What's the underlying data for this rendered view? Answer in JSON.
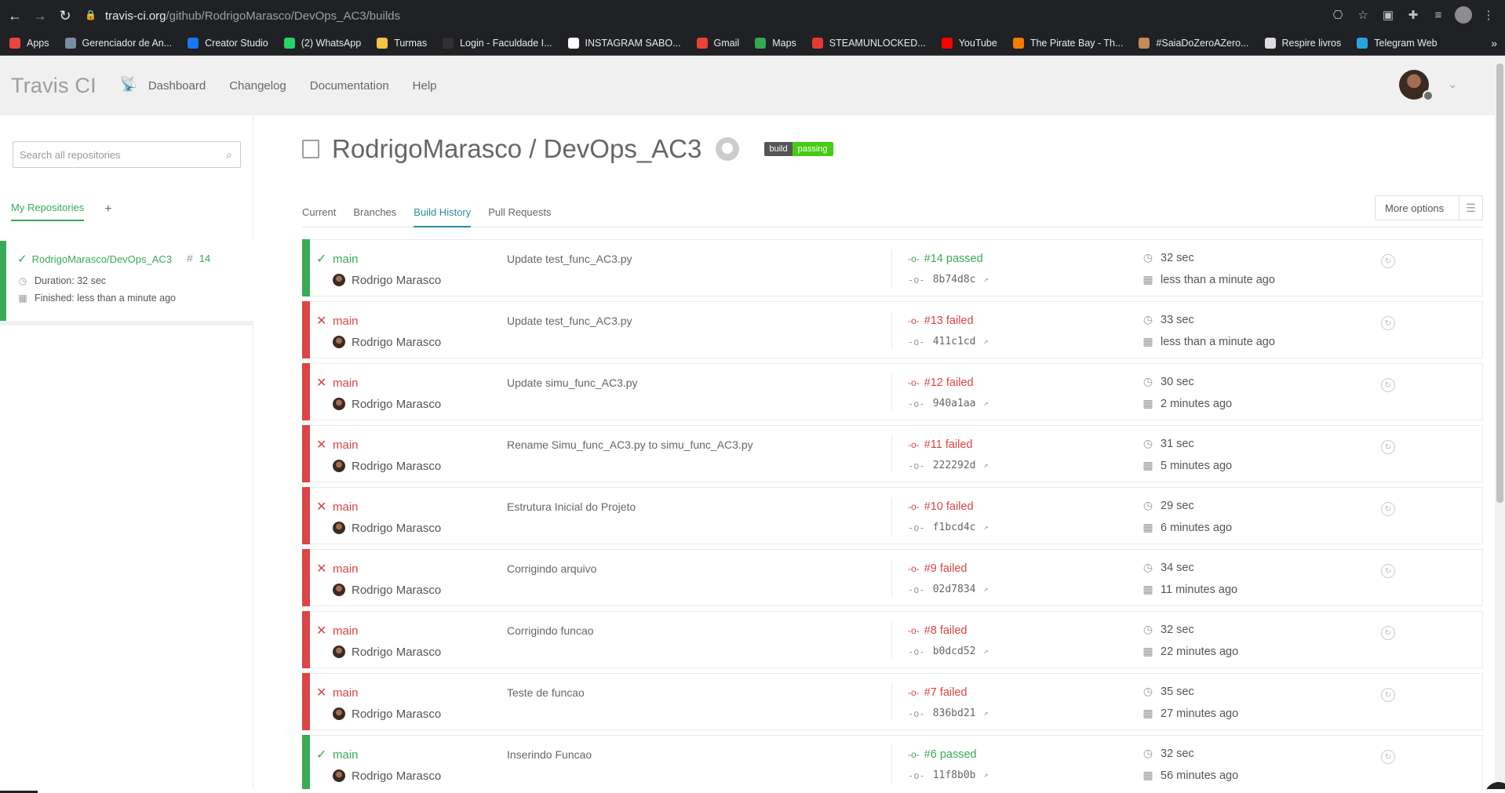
{
  "browser": {
    "url_host": "travis-ci.org",
    "url_path": "/github/RodrigoMarasco/DevOps_AC3/builds",
    "bookmarks": [
      {
        "label": "Apps",
        "color": "#e8453c"
      },
      {
        "label": "Gerenciador de An...",
        "color": "#7a8ca3"
      },
      {
        "label": "Creator Studio",
        "color": "#1877f2"
      },
      {
        "label": "(2) WhatsApp",
        "color": "#25d366"
      },
      {
        "label": "Turmas",
        "color": "#f6c445"
      },
      {
        "label": "Login - Faculdade I...",
        "color": "#303030"
      },
      {
        "label": "INSTAGRAM SABO...",
        "color": "#ffffff"
      },
      {
        "label": "Gmail",
        "color": "#ea4335"
      },
      {
        "label": "Maps",
        "color": "#34a853"
      },
      {
        "label": "STEAMUNLOCKED...",
        "color": "#e53935"
      },
      {
        "label": "YouTube",
        "color": "#ff0000"
      },
      {
        "label": "The Pirate Bay - Th...",
        "color": "#f57c00"
      },
      {
        "label": "#SaiaDoZeroAZero...",
        "color": "#c58b5a"
      },
      {
        "label": "Respire livros",
        "color": "#dddddd"
      },
      {
        "label": "Telegram Web",
        "color": "#2aa3df"
      }
    ]
  },
  "header": {
    "logo": "Travis CI",
    "nav": [
      "Dashboard",
      "Changelog",
      "Documentation",
      "Help"
    ]
  },
  "sidebar": {
    "search_placeholder": "Search all repositories",
    "tab_label": "My Repositories",
    "add_label": "+",
    "repo": {
      "name": "RodrigoMarasco/DevOps_AC3",
      "build_number": "14",
      "duration": "Duration: 32 sec",
      "finished": "Finished: less than a minute ago"
    }
  },
  "main": {
    "title": "RodrigoMarasco / DevOps_AC3",
    "badge_left": "build",
    "badge_right": "passing",
    "tabs": [
      "Current",
      "Branches",
      "Build History",
      "Pull Requests"
    ],
    "active_tab": "Build History",
    "more_options": "More options"
  },
  "builds": [
    {
      "status": "passed",
      "branch": "main",
      "author": "Rodrigo Marasco",
      "message": "Update test_func_AC3.py",
      "number": "#14 passed",
      "sha": "8b74d8c",
      "duration": "32 sec",
      "ago": "less than a minute ago"
    },
    {
      "status": "failed",
      "branch": "main",
      "author": "Rodrigo Marasco",
      "message": "Update test_func_AC3.py",
      "number": "#13 failed",
      "sha": "411c1cd",
      "duration": "33 sec",
      "ago": "less than a minute ago"
    },
    {
      "status": "failed",
      "branch": "main",
      "author": "Rodrigo Marasco",
      "message": "Update simu_func_AC3.py",
      "number": "#12 failed",
      "sha": "940a1aa",
      "duration": "30 sec",
      "ago": "2 minutes ago"
    },
    {
      "status": "failed",
      "branch": "main",
      "author": "Rodrigo Marasco",
      "message": "Rename Simu_func_AC3.py to simu_func_AC3.py",
      "number": "#11 failed",
      "sha": "222292d",
      "duration": "31 sec",
      "ago": "5 minutes ago"
    },
    {
      "status": "failed",
      "branch": "main",
      "author": "Rodrigo Marasco",
      "message": "Estrutura Inicial do Projeto",
      "number": "#10 failed",
      "sha": "f1bcd4c",
      "duration": "29 sec",
      "ago": "6 minutes ago"
    },
    {
      "status": "failed",
      "branch": "main",
      "author": "Rodrigo Marasco",
      "message": "Corrigindo arquivo",
      "number": "#9 failed",
      "sha": "02d7834",
      "duration": "34 sec",
      "ago": "11 minutes ago"
    },
    {
      "status": "failed",
      "branch": "main",
      "author": "Rodrigo Marasco",
      "message": "Corrigindo funcao",
      "number": "#8 failed",
      "sha": "b0dcd52",
      "duration": "32 sec",
      "ago": "22 minutes ago"
    },
    {
      "status": "failed",
      "branch": "main",
      "author": "Rodrigo Marasco",
      "message": "Teste de funcao",
      "number": "#7 failed",
      "sha": "836bd21",
      "duration": "35 sec",
      "ago": "27 minutes ago"
    },
    {
      "status": "passed",
      "branch": "main",
      "author": "Rodrigo Marasco",
      "message": "Inserindo Funcao",
      "number": "#6 passed",
      "sha": "11f8b0b",
      "duration": "32 sec",
      "ago": "56 minutes ago"
    }
  ],
  "colors": {
    "passed": "#39aa56",
    "failed": "#db4545",
    "accent": "#2b8ea0"
  }
}
